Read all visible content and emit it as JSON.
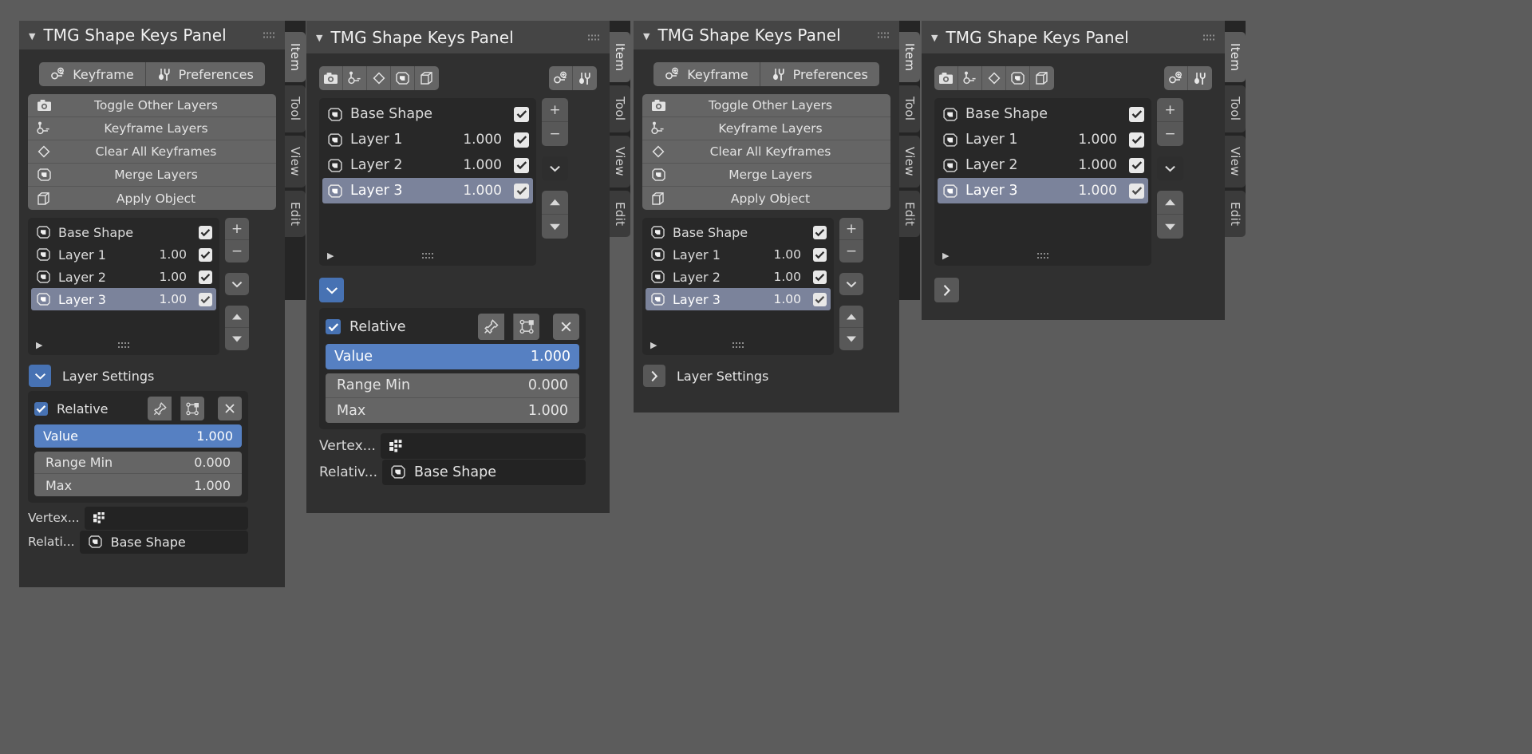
{
  "app": {
    "background": "#5c5c5c",
    "accent": "#4772b3",
    "selection": "#7b839b",
    "panel_bg": "#303030",
    "header_bg": "#454545"
  },
  "panel_title": "TMG Shape Keys Panel",
  "header_ops": {
    "keyframe_label": "Keyframe",
    "preferences_label": "Preferences"
  },
  "operators": [
    {
      "label": "Toggle Other Layers",
      "icon": "camera-icon"
    },
    {
      "label": "Keyframe Layers",
      "icon": "keyframe-key-icon"
    },
    {
      "label": "Clear All Keyframes",
      "icon": "diamond-icon"
    },
    {
      "label": "Merge Layers",
      "icon": "shapekey-icon"
    },
    {
      "label": "Apply Object",
      "icon": "cube-icon"
    }
  ],
  "toolbar_icons": {
    "left": [
      "camera-icon",
      "keyframe-key-icon",
      "diamond-icon",
      "shapekey-icon",
      "cube-icon"
    ],
    "right": [
      "add-keyframe-icon",
      "preferences-tools-icon"
    ]
  },
  "list_two_dec": {
    "rows": [
      {
        "name": "Base Shape",
        "value": "",
        "checked": true,
        "selected": false
      },
      {
        "name": "Layer 1",
        "value": "1.00",
        "checked": true,
        "selected": false
      },
      {
        "name": "Layer 2",
        "value": "1.00",
        "checked": true,
        "selected": false
      },
      {
        "name": "Layer 3",
        "value": "1.00",
        "checked": true,
        "selected": true
      }
    ]
  },
  "list_three_dec": {
    "rows": [
      {
        "name": "Base Shape",
        "value": "",
        "checked": true,
        "selected": false
      },
      {
        "name": "Layer 1",
        "value": "1.000",
        "checked": true,
        "selected": false
      },
      {
        "name": "Layer 2",
        "value": "1.000",
        "checked": true,
        "selected": false
      },
      {
        "name": "Layer 3",
        "value": "1.000",
        "checked": true,
        "selected": true
      }
    ]
  },
  "side_buttons": {
    "add": "+",
    "remove": "−",
    "menu": "chevron-down-icon",
    "move_up": "triangle-up-icon",
    "move_down": "triangle-down-icon"
  },
  "layer_settings": {
    "title": "Layer Settings",
    "expanded_arrow": "chevron-down-icon",
    "collapsed_arrow": "chevron-right-icon",
    "relative_label": "Relative",
    "relative_checked": true,
    "pin_icon": "pin-icon",
    "bounds_icon": "bounds-select-icon",
    "close_icon": "close-icon",
    "value_label": "Value",
    "value": "1.000",
    "range_min_label": "Range Min",
    "range_min": "0.000",
    "max_label": "Max",
    "max": "1.000",
    "vertex_label_short": "Vertex...",
    "vertex_value": "",
    "vertex_icon": "vertex-group-icon",
    "relative_to_label_short": "Relati...",
    "relative_to_label_alt": "Relativ...",
    "relative_to_value": "Base Shape",
    "relative_to_icon": "shapekey-icon"
  },
  "tabs": [
    {
      "label": "Item",
      "active": true
    },
    {
      "label": "Tool",
      "active": false
    },
    {
      "label": "View",
      "active": false
    },
    {
      "label": "Edit",
      "active": false
    }
  ],
  "panels": [
    {
      "id": "panel-1",
      "variant": "labeled-ops",
      "settings": "expanded",
      "decimals": "two"
    },
    {
      "id": "panel-2",
      "variant": "icon-toolbar",
      "settings": "expanded",
      "decimals": "three"
    },
    {
      "id": "panel-3",
      "variant": "labeled-ops",
      "settings": "collapsed",
      "decimals": "two"
    },
    {
      "id": "panel-4",
      "variant": "icon-toolbar",
      "settings": "collapsed",
      "decimals": "three"
    }
  ]
}
